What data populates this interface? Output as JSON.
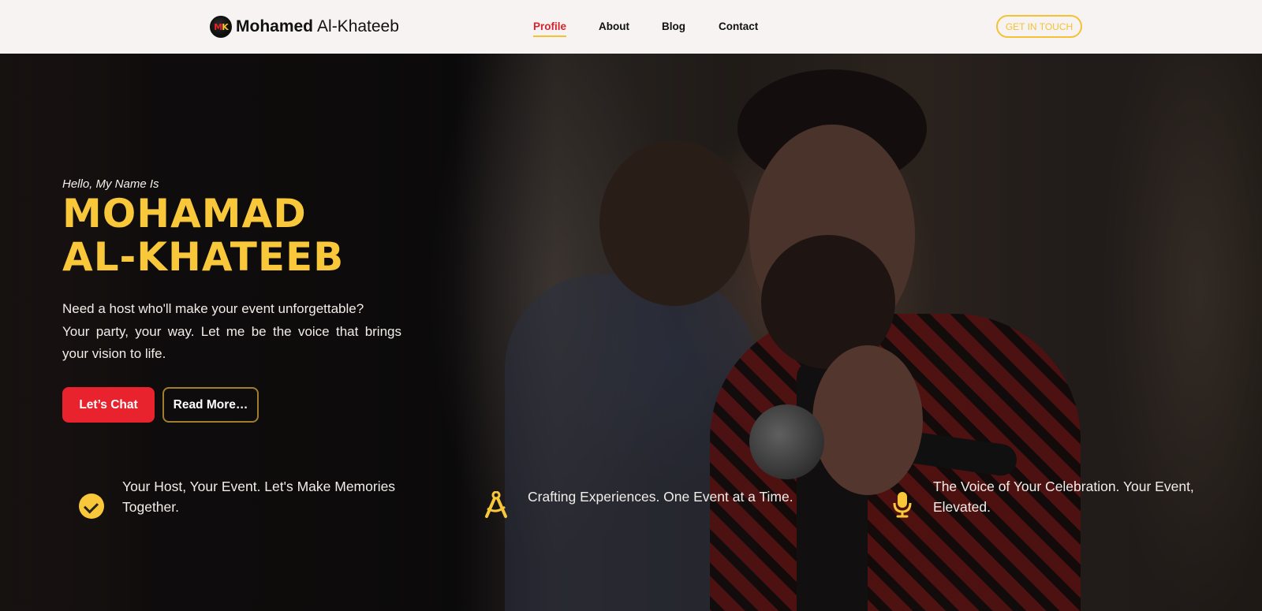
{
  "header": {
    "logo_initials_m": "M",
    "logo_initials_k": "K",
    "logo_first": "Mohamed",
    "logo_last": "Al-Khateeb",
    "nav": [
      {
        "label": "Profile",
        "active": true
      },
      {
        "label": "About",
        "active": false
      },
      {
        "label": "Blog",
        "active": false
      },
      {
        "label": "Contact",
        "active": false
      }
    ],
    "cta_label": "GET IN TOUCH"
  },
  "hero": {
    "intro": "Hello, My Name Is",
    "name_line1": "MOHAMAD",
    "name_line2": "AL-KHATEEB",
    "tagline_line1": "Need a host who'll make your event unforgettable?",
    "tagline_line2": "Your party, your way. Let me be the voice that brings",
    "tagline_line3": "your vision to life.",
    "primary_button": "Let’s Chat",
    "secondary_button": "Read More…"
  },
  "features": [
    {
      "icon": "check-circle-icon",
      "text_line1": "Your Host, Your Event. Let's Make Memories",
      "text_line2": "Together."
    },
    {
      "icon": "drafting-compass-icon",
      "text_line1": "Crafting Experiences. One Event at a Time.",
      "text_line2": ""
    },
    {
      "icon": "microphone-icon",
      "text_line1": "The Voice of Your Celebration. Your Event,",
      "text_line2": "Elevated."
    }
  ],
  "colors": {
    "accent_yellow": "#f8c83a",
    "accent_red": "#e8232d",
    "nav_bg": "#f7f3f2"
  }
}
